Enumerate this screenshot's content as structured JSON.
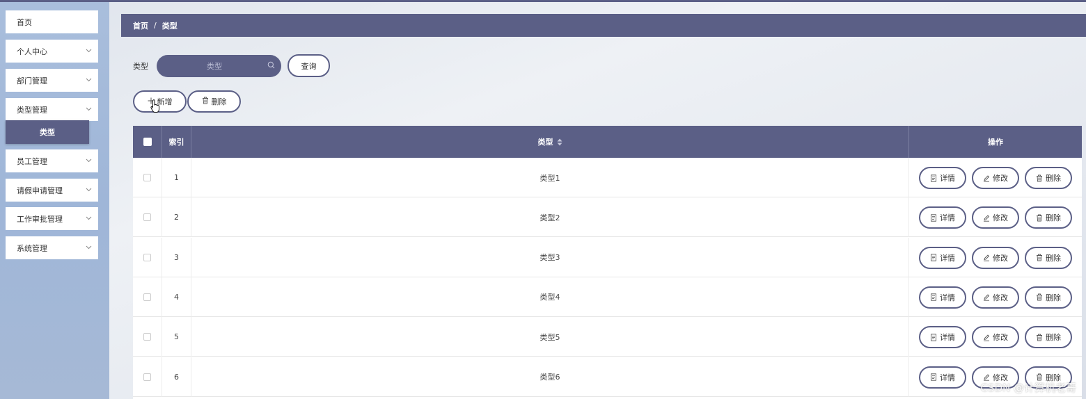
{
  "sidebar": {
    "items": [
      {
        "label": "首页",
        "has_chevron": false
      },
      {
        "label": "个人中心",
        "has_chevron": true
      },
      {
        "label": "部门管理",
        "has_chevron": true
      },
      {
        "label": "类型管理",
        "has_chevron": true
      },
      {
        "label": "员工管理",
        "has_chevron": true
      },
      {
        "label": "请假申请管理",
        "has_chevron": true
      },
      {
        "label": "工作审批管理",
        "has_chevron": true
      },
      {
        "label": "系统管理",
        "has_chevron": true
      }
    ],
    "active_subitem": "类型"
  },
  "breadcrumb": {
    "home": "首页",
    "separator": "/",
    "current": "类型"
  },
  "search": {
    "label": "类型",
    "placeholder": "类型",
    "query_button": "查询"
  },
  "toolbar": {
    "add_label": "新增",
    "delete_label": "删除"
  },
  "table": {
    "headers": {
      "index": "索引",
      "type": "类型",
      "actions": "操作"
    },
    "rows": [
      {
        "index": "1",
        "type": "类型1"
      },
      {
        "index": "2",
        "type": "类型2"
      },
      {
        "index": "3",
        "type": "类型3"
      },
      {
        "index": "4",
        "type": "类型4"
      },
      {
        "index": "5",
        "type": "类型5"
      },
      {
        "index": "6",
        "type": "类型6"
      }
    ],
    "row_actions": {
      "detail": "详情",
      "edit": "修改",
      "delete": "删除"
    }
  },
  "watermark": "CSDN @计算机老哥",
  "colors": {
    "primary": "#5b5f86",
    "sidebar_bg": "#a3b9da"
  }
}
